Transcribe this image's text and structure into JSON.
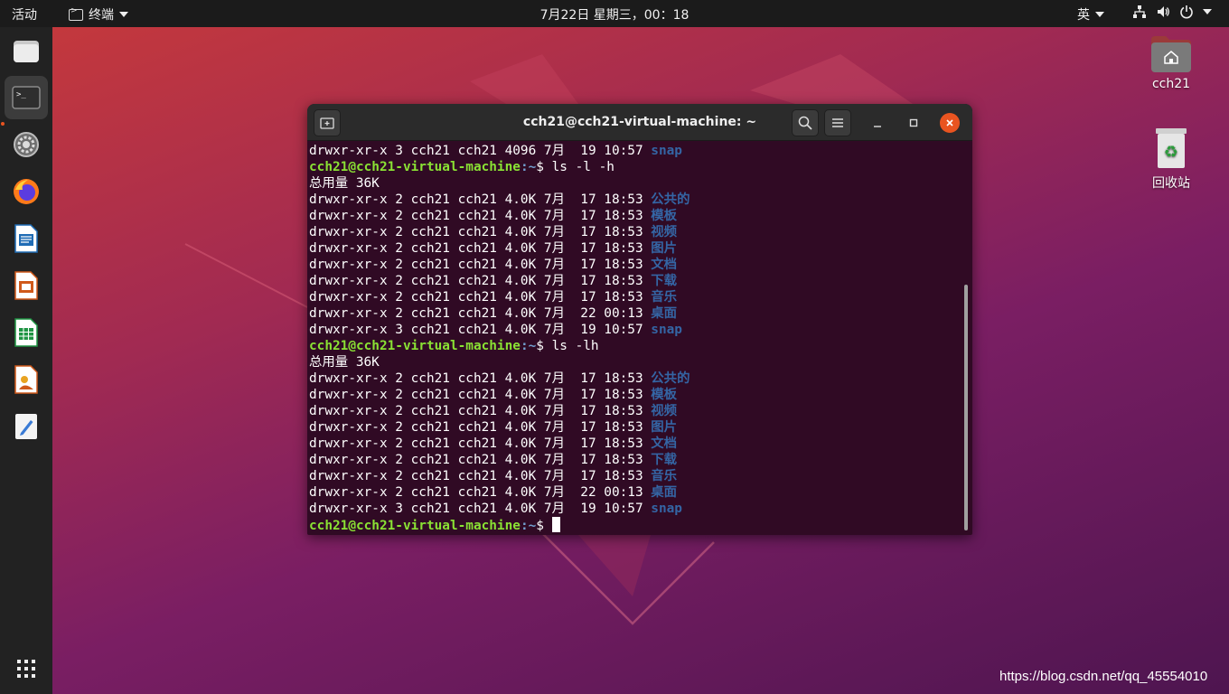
{
  "topbar": {
    "activities": "活动",
    "app_name": "终端",
    "clock": "7月22日 星期三，00：18",
    "input_method": "英"
  },
  "dock": {
    "items": [
      {
        "name": "files",
        "icon": "folder-icon"
      },
      {
        "name": "terminal",
        "icon": "terminal-icon",
        "active": true
      },
      {
        "name": "settings",
        "icon": "gear-icon"
      },
      {
        "name": "firefox",
        "icon": "firefox-icon"
      },
      {
        "name": "writer",
        "icon": "writer-icon"
      },
      {
        "name": "impress",
        "icon": "impress-icon"
      },
      {
        "name": "calc",
        "icon": "calc-icon"
      },
      {
        "name": "shotwell",
        "icon": "photo-viewer-icon"
      },
      {
        "name": "text-editor",
        "icon": "text-editor-icon"
      },
      {
        "name": "show-apps",
        "icon": "app-grid-icon"
      }
    ]
  },
  "desktop": {
    "home_label": "cch21",
    "trash_label": "回收站"
  },
  "terminal": {
    "title": "cch21@cch21-virtual-machine: ~",
    "prompt_user": "cch21@cch21-virtual-machine",
    "prompt_path": ":~",
    "prompt_symbol": "$ ",
    "lines": [
      {
        "type": "entry",
        "text": "drwxr-xr-x 3 cch21 cch21 4096 7月  19 10:57 ",
        "name": "snap"
      },
      {
        "type": "prompt",
        "cmd": "ls -l -h"
      },
      {
        "type": "text",
        "text": "总用量 36K"
      },
      {
        "type": "entry",
        "text": "drwxr-xr-x 2 cch21 cch21 4.0K 7月  17 18:53 ",
        "name": "公共的"
      },
      {
        "type": "entry",
        "text": "drwxr-xr-x 2 cch21 cch21 4.0K 7月  17 18:53 ",
        "name": "模板"
      },
      {
        "type": "entry",
        "text": "drwxr-xr-x 2 cch21 cch21 4.0K 7月  17 18:53 ",
        "name": "视频"
      },
      {
        "type": "entry",
        "text": "drwxr-xr-x 2 cch21 cch21 4.0K 7月  17 18:53 ",
        "name": "图片"
      },
      {
        "type": "entry",
        "text": "drwxr-xr-x 2 cch21 cch21 4.0K 7月  17 18:53 ",
        "name": "文档"
      },
      {
        "type": "entry",
        "text": "drwxr-xr-x 2 cch21 cch21 4.0K 7月  17 18:53 ",
        "name": "下载"
      },
      {
        "type": "entry",
        "text": "drwxr-xr-x 2 cch21 cch21 4.0K 7月  17 18:53 ",
        "name": "音乐"
      },
      {
        "type": "entry",
        "text": "drwxr-xr-x 2 cch21 cch21 4.0K 7月  22 00:13 ",
        "name": "桌面"
      },
      {
        "type": "entry",
        "text": "drwxr-xr-x 3 cch21 cch21 4.0K 7月  19 10:57 ",
        "name": "snap"
      },
      {
        "type": "prompt",
        "cmd": "ls -lh"
      },
      {
        "type": "text",
        "text": "总用量 36K"
      },
      {
        "type": "entry",
        "text": "drwxr-xr-x 2 cch21 cch21 4.0K 7月  17 18:53 ",
        "name": "公共的"
      },
      {
        "type": "entry",
        "text": "drwxr-xr-x 2 cch21 cch21 4.0K 7月  17 18:53 ",
        "name": "模板"
      },
      {
        "type": "entry",
        "text": "drwxr-xr-x 2 cch21 cch21 4.0K 7月  17 18:53 ",
        "name": "视频"
      },
      {
        "type": "entry",
        "text": "drwxr-xr-x 2 cch21 cch21 4.0K 7月  17 18:53 ",
        "name": "图片"
      },
      {
        "type": "entry",
        "text": "drwxr-xr-x 2 cch21 cch21 4.0K 7月  17 18:53 ",
        "name": "文档"
      },
      {
        "type": "entry",
        "text": "drwxr-xr-x 2 cch21 cch21 4.0K 7月  17 18:53 ",
        "name": "下载"
      },
      {
        "type": "entry",
        "text": "drwxr-xr-x 2 cch21 cch21 4.0K 7月  17 18:53 ",
        "name": "音乐"
      },
      {
        "type": "entry",
        "text": "drwxr-xr-x 2 cch21 cch21 4.0K 7月  22 00:13 ",
        "name": "桌面"
      },
      {
        "type": "entry",
        "text": "drwxr-xr-x 3 cch21 cch21 4.0K 7月  19 10:57 ",
        "name": "snap"
      },
      {
        "type": "prompt",
        "cmd": "",
        "cursor": true
      }
    ]
  },
  "watermark": "https://blog.csdn.net/qq_45554010",
  "colors": {
    "terminal_bg": "#300a24",
    "prompt_user": "#8ae234",
    "prompt_path": "#729fcf",
    "directory": "#3465a4",
    "accent": "#e95420"
  }
}
